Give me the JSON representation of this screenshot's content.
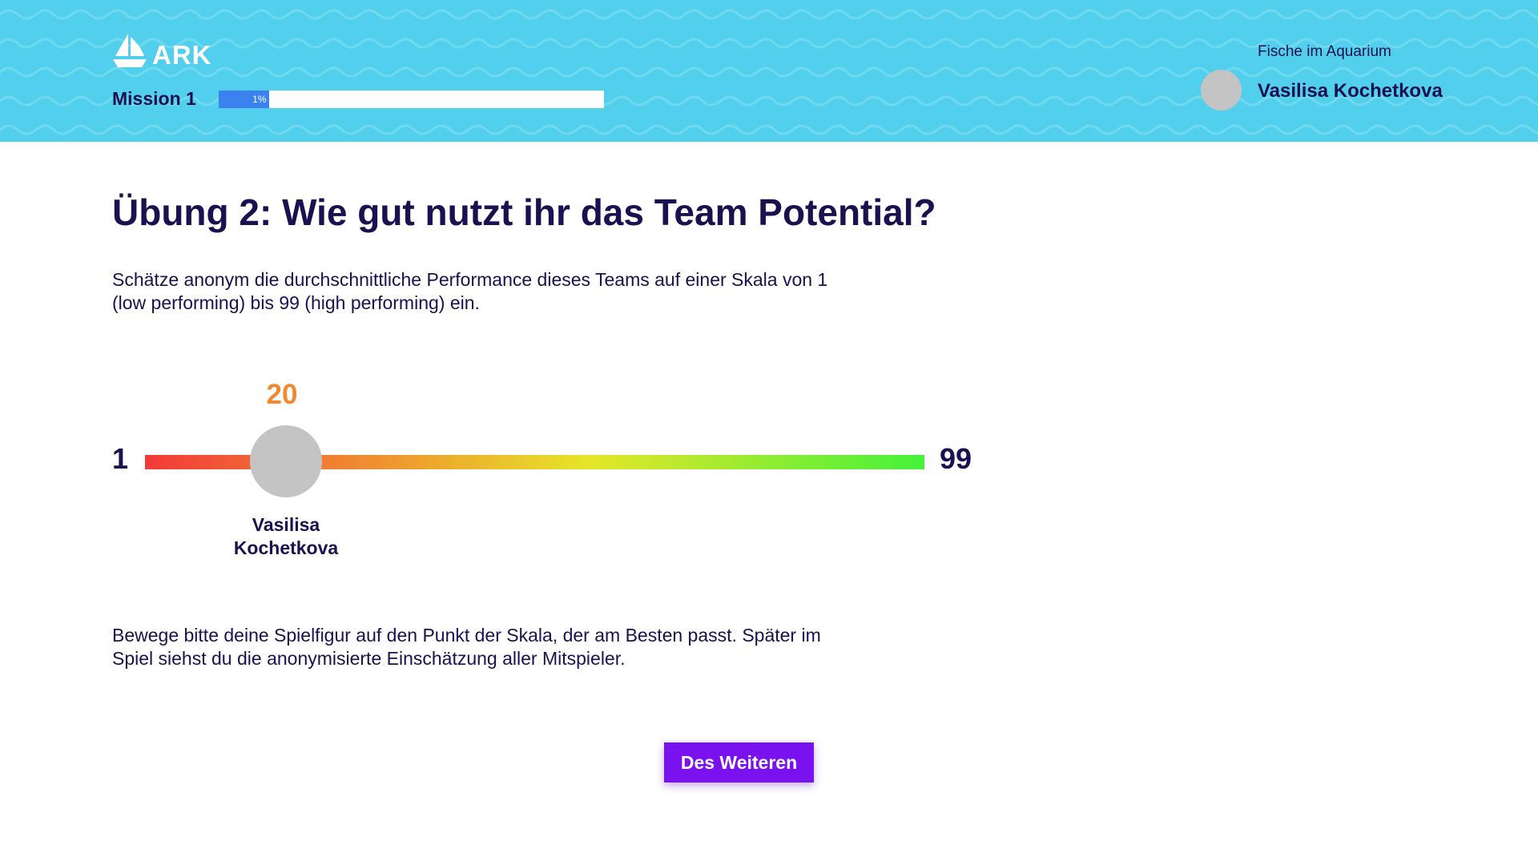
{
  "header": {
    "brand": "ARK",
    "mission_label": "Mission 1",
    "progress_text": "1%",
    "progress_fraction": 0.13,
    "room_label": "Fische im Aquarium",
    "user_name": "Vasilisa Kochetkova",
    "colors": {
      "background": "#52cfec",
      "progress": "#3b82f0"
    }
  },
  "main": {
    "title": "Übung 2: Wie gut nutzt ihr das Team Potential?",
    "intro_line1": "Schätze anonym die durchschnittliche Performance dieses Teams auf einer Skala von 1",
    "intro_line2": "(low performing) bis 99 (high performing) ein.",
    "scale": {
      "min": "1",
      "max": "99",
      "value": "20",
      "player_first": "Vasilisa",
      "player_last": "Kochetkova",
      "colors": {
        "start": "#f23a3a",
        "mid": "#e6e629",
        "end": "#44f23a",
        "value": "#ef8a30"
      }
    },
    "hint_line1": "Bewege bitte deine Spielfigur auf den Punkt der Skala, der am Besten passt. Später im",
    "hint_line2": "Spiel siehst du die anonymisierte Einschätzung aller Mitspieler.",
    "next_button": "Des Weiteren",
    "button_color": "#7a12f0"
  }
}
